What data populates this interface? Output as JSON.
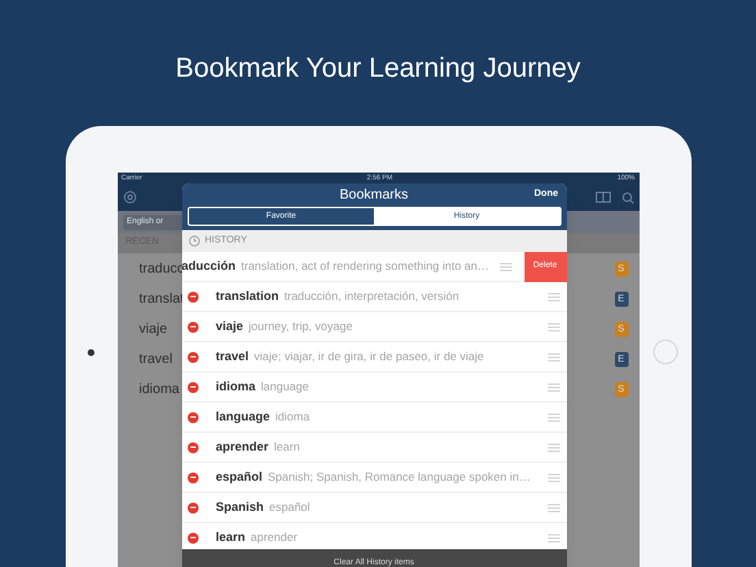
{
  "headline": "Bookmark Your Learning Journey",
  "status_bar": {
    "carrier": "Carrier",
    "time": "2:56 PM",
    "battery": "100%"
  },
  "background_app": {
    "search": {
      "placeholder": "English or"
    },
    "section": "RECEN",
    "rows": [
      {
        "word": "traducc",
        "badge": "S",
        "color": "#c8801e"
      },
      {
        "word": "translat",
        "badge": "E",
        "color": "#2e4a6b"
      },
      {
        "word": "viaje",
        "badge": "S",
        "color": "#c8801e"
      },
      {
        "word": "travel",
        "badge": "E",
        "color": "#2e4a6b"
      },
      {
        "word": "idioma",
        "badge": "S",
        "color": "#c8801e"
      }
    ]
  },
  "popover": {
    "title": "Bookmarks",
    "done": "Done",
    "tabs": [
      {
        "label": "Favorite",
        "selected": false
      },
      {
        "label": "History",
        "selected": true
      }
    ],
    "section": "HISTORY",
    "rows": [
      {
        "word": "aducción",
        "definition": "translation, act of rendering something into an…",
        "swiped": true,
        "action": "Delete"
      },
      {
        "word": "translation",
        "definition": "traducción, interpretación, versión",
        "swiped": false
      },
      {
        "word": "viaje",
        "definition": "journey, trip, voyage",
        "swiped": false
      },
      {
        "word": "travel",
        "definition": "viaje; viajar, ir de gira, ir de paseo, ir de viaje",
        "swiped": false
      },
      {
        "word": "idioma",
        "definition": "language",
        "swiped": false
      },
      {
        "word": "language",
        "definition": "idioma",
        "swiped": false
      },
      {
        "word": "aprender",
        "definition": "learn",
        "swiped": false
      },
      {
        "word": "español",
        "definition": "Spanish; Spanish, Romance language spoken in…",
        "swiped": false
      },
      {
        "word": "Spanish",
        "definition": "español",
        "swiped": false
      },
      {
        "word": "learn",
        "definition": "aprender",
        "swiped": false
      }
    ],
    "footer": "Clear All History items"
  }
}
